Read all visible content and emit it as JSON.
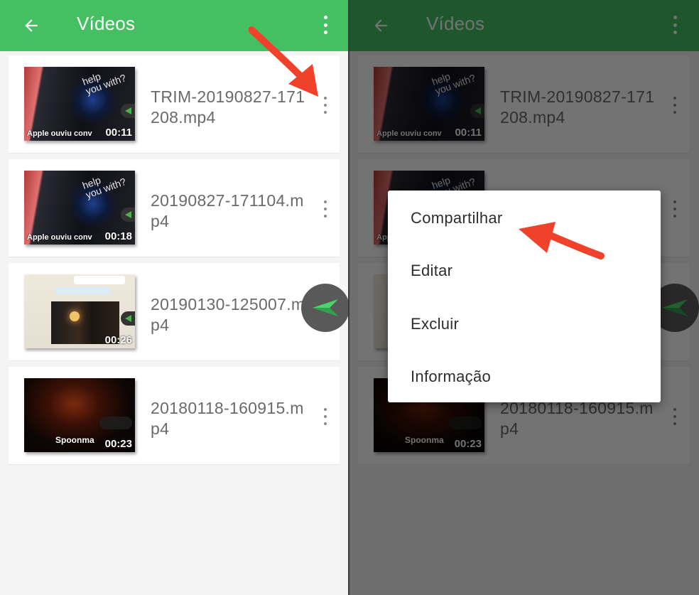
{
  "colors": {
    "accent": "#44c062",
    "accent_dim": "#1e6a33",
    "arrow": "#f0412a"
  },
  "appbar": {
    "title": "Vídeos"
  },
  "videos": [
    {
      "name": "TRIM-20190827-171208.mp4",
      "duration": "00:11",
      "caption": "Apple ouviu conv",
      "overlay_text": "help\nyou with?"
    },
    {
      "name": "20190827-171104.mp4",
      "duration": "00:18",
      "caption": "Apple ouviu conv",
      "overlay_text": "help\nyou with?"
    },
    {
      "name": "20190130-125007.mp4",
      "duration": "00:26"
    },
    {
      "name": "20180118-160915.mp4",
      "duration": "00:23",
      "caption": "Spoonma"
    }
  ],
  "context_menu": {
    "items": [
      "Compartilhar",
      "Editar",
      "Excluir",
      "Informação"
    ]
  },
  "icons": {
    "back": "arrow-left-icon",
    "overflow": "kebab-icon",
    "share_fab": "paper-plane-icon"
  }
}
